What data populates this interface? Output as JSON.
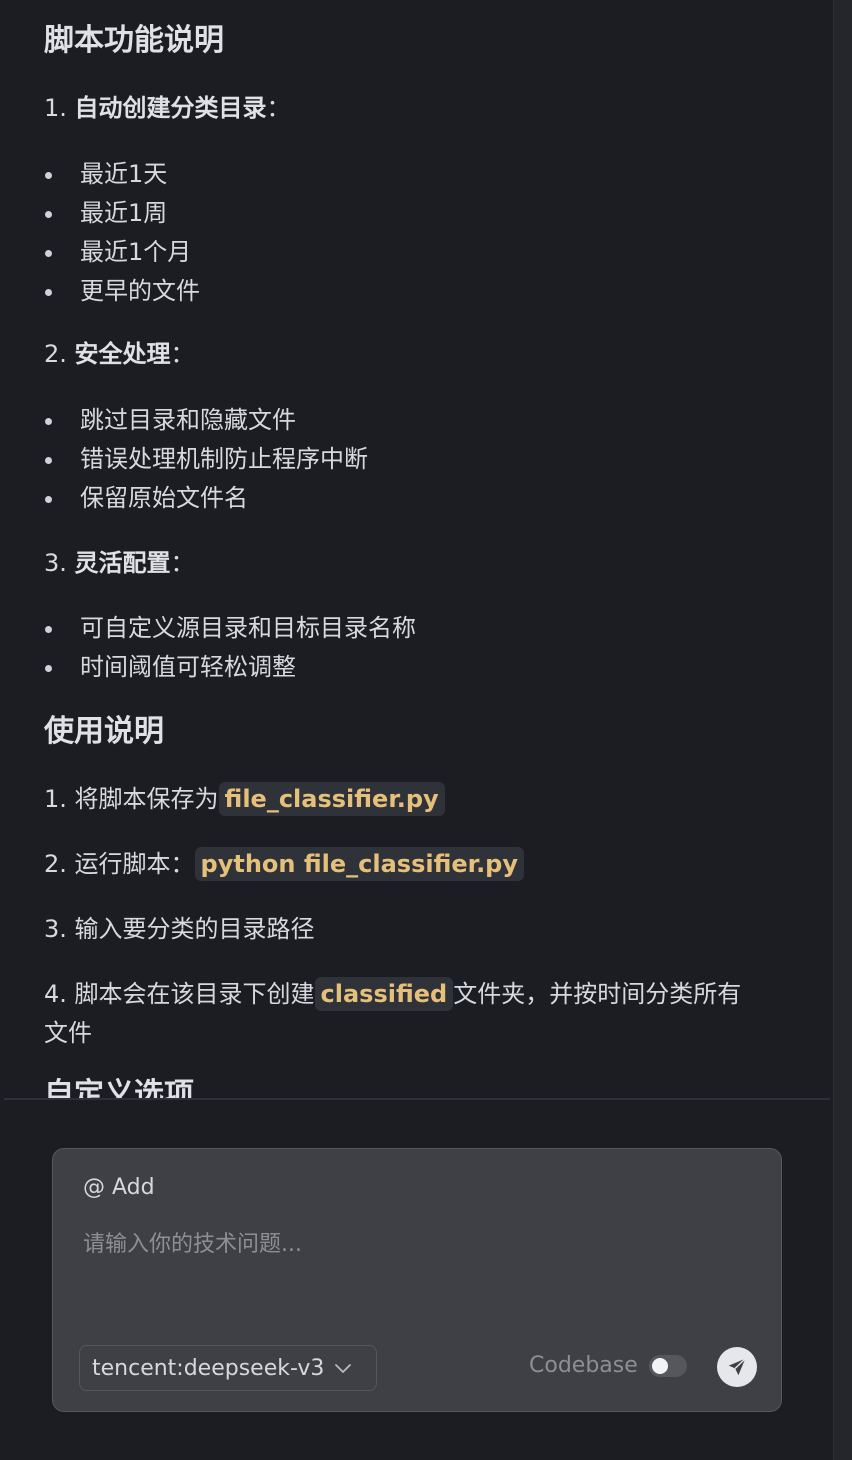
{
  "doc": {
    "heading_functions": "脚本功能说明",
    "section1": {
      "number": "1.",
      "title": "自动创建分类目录",
      "colon": "："
    },
    "section1_items": [
      "最近1天",
      "最近1周",
      "最近1个月",
      "更早的文件"
    ],
    "section2": {
      "number": "2.",
      "title": "安全处理",
      "colon": "："
    },
    "section2_items": [
      "跳过目录和隐藏文件",
      "错误处理机制防止程序中断",
      "保留原始文件名"
    ],
    "section3": {
      "number": "3.",
      "title": "灵活配置",
      "colon": "："
    },
    "section3_items": [
      "可自定义源目录和目标目录名称",
      "时间阈值可轻松调整"
    ],
    "heading_usage": "使用说明",
    "usage1": {
      "prefix": "1. 将脚本保存为",
      "code": "file_classifier.py"
    },
    "usage2": {
      "prefix": "2. 运行脚本：",
      "code": "python file_classifier.py"
    },
    "usage3": {
      "text": "3. 输入要分类的目录路径"
    },
    "usage4": {
      "prefix": "4. 脚本会在该目录下创建",
      "code": "classified",
      "suffix": "文件夹，并按时间分类所有",
      "line2": "文件"
    },
    "heading_custom": "自定义选项"
  },
  "input_panel": {
    "add_label": "@ Add",
    "placeholder": "请输入你的技术问题...",
    "model_value": "tencent:deepseek-v3",
    "codebase_label": "Codebase",
    "codebase_enabled": false
  },
  "icons": {
    "chevron": "chevron-down-icon",
    "send": "send-icon"
  },
  "colors": {
    "background": "#1b1d23",
    "code_text": "#e5c07b",
    "code_bg": "#30323a",
    "panel_bg": "#3f4045"
  }
}
